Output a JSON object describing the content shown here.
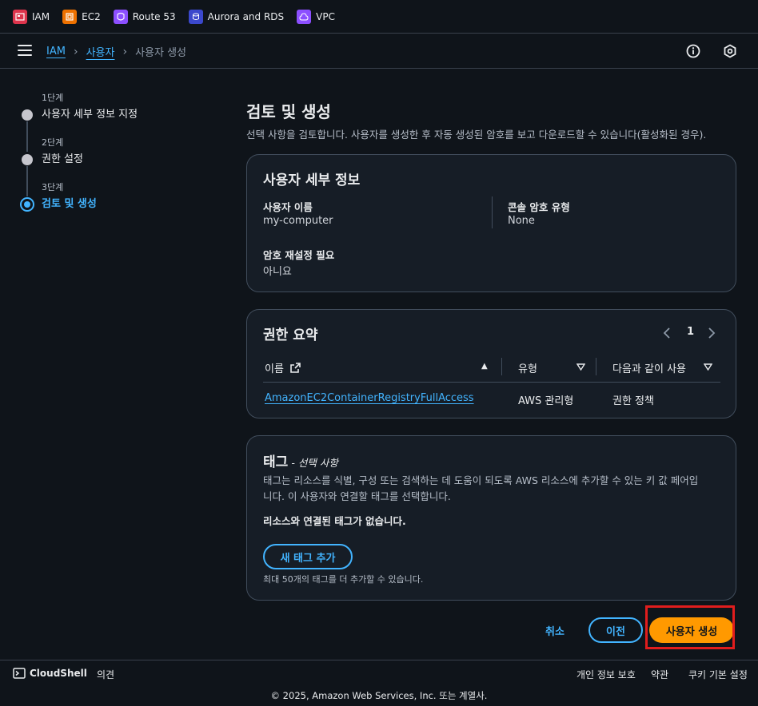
{
  "favorites": [
    {
      "label": "IAM",
      "color": "#dd344c"
    },
    {
      "label": "EC2",
      "color": "#ed7100"
    },
    {
      "label": "Route 53",
      "color": "#8c4fff"
    },
    {
      "label": "Aurora and RDS",
      "color": "#3b48cc"
    },
    {
      "label": "VPC",
      "color": "#8c4fff"
    }
  ],
  "breadcrumb": {
    "root": "IAM",
    "parent": "사용자",
    "current": "사용자 생성"
  },
  "steps": [
    {
      "num": "1단계",
      "title": "사용자 세부 정보 지정"
    },
    {
      "num": "2단계",
      "title": "권한 설정"
    },
    {
      "num": "3단계",
      "title": "검토 및 생성"
    }
  ],
  "page": {
    "title": "검토 및 생성",
    "description": "선택 사항을 검토합니다. 사용자를 생성한 후 자동 생성된 암호를 보고 다운로드할 수 있습니다(활성화된 경우)."
  },
  "user_details": {
    "title": "사용자 세부 정보",
    "username_label": "사용자 이름",
    "username_value": "my-computer",
    "console_pw_label": "콘솔 암호 유형",
    "console_pw_value": "None",
    "reset_label": "암호 재설정 필요",
    "reset_value": "아니요"
  },
  "permissions": {
    "title": "권한 요약",
    "page": "1",
    "columns": [
      "이름",
      "유형",
      "다음과 같이 사용"
    ],
    "rows": [
      {
        "name": "AmazonEC2ContainerRegistryFullAccess",
        "type": "AWS 관리형",
        "used_as": "권한 정책"
      }
    ]
  },
  "tags": {
    "title": "태그",
    "optional": "- 선택 사항",
    "desc_line1": "태그는 리소스를 식별, 구성 또는 검색하는 데 도움이 되도록 AWS 리소스에 추가할 수 있는 키 값 페어입",
    "desc_line2": "니다. 이 사용자와 연결할 태그를 선택합니다.",
    "empty": "리소스와 연결된 태그가 없습니다.",
    "add_button": "새 태그 추가",
    "limit": "최대 50개의 태그를 더 추가할 수 있습니다."
  },
  "actions": {
    "cancel": "취소",
    "previous": "이전",
    "create": "사용자 생성"
  },
  "footer": {
    "cloudshell": "CloudShell",
    "feedback": "의견",
    "privacy": "개인 정보 보호",
    "terms": "약관",
    "cookies": "쿠키 기본 설정",
    "copyright": "© 2025, Amazon Web Services, Inc. 또는 계열사."
  }
}
